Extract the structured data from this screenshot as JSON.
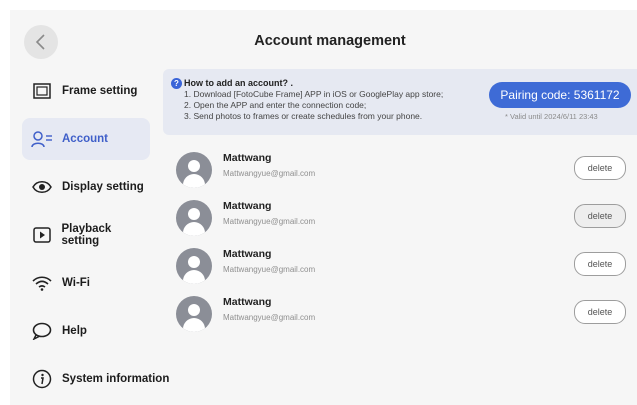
{
  "header": {
    "title": "Account management",
    "back_icon": "chevron-left-icon"
  },
  "sidebar": {
    "items": [
      {
        "label": "Frame setting",
        "icon": "frame-icon",
        "active": false
      },
      {
        "label": "Account",
        "icon": "account-icon",
        "active": true
      },
      {
        "label": "Display setting",
        "icon": "eye-icon",
        "active": false
      },
      {
        "label": "Playback setting",
        "icon": "play-icon",
        "active": false
      },
      {
        "label": "Wi-Fi",
        "icon": "wifi-icon",
        "active": false
      },
      {
        "label": "Help",
        "icon": "help-bubble-icon",
        "active": false
      },
      {
        "label": "System information",
        "icon": "info-icon",
        "active": false
      }
    ]
  },
  "info": {
    "heading": "How to add an account? .",
    "steps": [
      "1. Download [FotoCube Frame] APP in iOS or GooglePlay app store;",
      "2. Open the APP and enter the connection code;",
      "3. Send photos to frames or create schedules from your phone."
    ],
    "pairing_label": "Pairing code: 5361172",
    "valid_until": "* Valid until 2024/6/11 23:43"
  },
  "accounts": [
    {
      "name": "Mattwang",
      "email": "Mattwangyue@gmail.com",
      "delete_label": "delete"
    },
    {
      "name": "Mattwang",
      "email": "Mattwangyue@gmail.com",
      "delete_label": "delete"
    },
    {
      "name": "Mattwang",
      "email": "Mattwangyue@gmail.com",
      "delete_label": "delete"
    },
    {
      "name": "Mattwang",
      "email": "Mattwangyue@gmail.com",
      "delete_label": "delete"
    }
  ],
  "colors": {
    "accent": "#3e6bd6",
    "active_bg": "#e6e9f3",
    "panel_bg": "#e6e9f2"
  }
}
